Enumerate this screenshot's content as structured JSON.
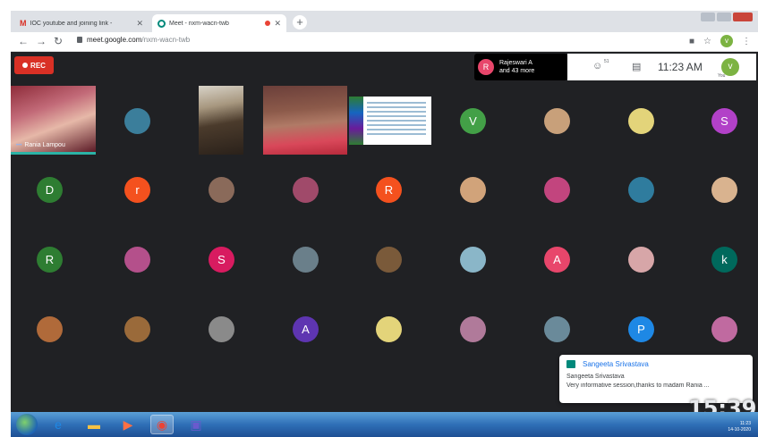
{
  "browser": {
    "tabs": [
      {
        "title": "IOC youtube and joining link -",
        "favicon": "gmail-icon"
      },
      {
        "title": "Meet - nxm-wacn-twb",
        "favicon": "meet-icon"
      }
    ],
    "url_host": "meet.google.com",
    "url_path": "/nxm-wacn-twb",
    "profile_initial": "v"
  },
  "meet": {
    "rec_label": "REC",
    "participants": {
      "initial": "R",
      "line1": "Rajeswari A",
      "line2": "and 43 more",
      "count": "51"
    },
    "clock": "11:23 AM",
    "you_initial": "v",
    "you_label": "You",
    "speaker_name": "Rania Lampou",
    "avatars_row1": [
      {
        "initial": "",
        "color": "#3b7e9b"
      },
      {
        "initial": "V",
        "color": "#43a047"
      },
      {
        "initial": "",
        "color": "#c8a07a"
      },
      {
        "initial": "",
        "color": "#e3d47a"
      },
      {
        "initial": "S",
        "color": "#b241c8"
      }
    ],
    "avatars_row2": [
      {
        "initial": "D",
        "color": "#2e7d32"
      },
      {
        "initial": "r",
        "color": "#f4511e"
      },
      {
        "initial": "",
        "color": "#8a6a5a"
      },
      {
        "initial": "",
        "color": "#a04a6a"
      },
      {
        "initial": "R",
        "color": "#f4511e"
      },
      {
        "initial": "",
        "color": "#d1a37a"
      },
      {
        "initial": "",
        "color": "#c2457e"
      },
      {
        "initial": "",
        "color": "#2f7c9e"
      },
      {
        "initial": "",
        "color": "#d9b38f"
      }
    ],
    "avatars_row3": [
      {
        "initial": "R",
        "color": "#2e7d32"
      },
      {
        "initial": "",
        "color": "#b4508b"
      },
      {
        "initial": "S",
        "color": "#d81b60"
      },
      {
        "initial": "",
        "color": "#6a7f8a"
      },
      {
        "initial": "",
        "color": "#7a5a3a"
      },
      {
        "initial": "",
        "color": "#8ab6c8"
      },
      {
        "initial": "A",
        "color": "#e8466b"
      },
      {
        "initial": "",
        "color": "#d7a6a8"
      },
      {
        "initial": "k",
        "color": "#00695c"
      }
    ],
    "avatars_row4": [
      {
        "initial": "",
        "color": "#b06a3a"
      },
      {
        "initial": "",
        "color": "#9a6a3a"
      },
      {
        "initial": "",
        "color": "#8a8a8a"
      },
      {
        "initial": "A",
        "color": "#5e35b1"
      },
      {
        "initial": "",
        "color": "#e3d47a"
      },
      {
        "initial": "",
        "color": "#b07a9a"
      },
      {
        "initial": "",
        "color": "#6a8a9a"
      },
      {
        "initial": "P",
        "color": "#1e88e5"
      },
      {
        "initial": "",
        "color": "#c06aa0"
      }
    ]
  },
  "toast": {
    "title": "Sangeeta Srivastava",
    "sender": "Sangeeta Srivastava",
    "message": "Very informative session,thanks to madam Rania ..."
  },
  "overlay_clock": "15:39",
  "taskbar": {
    "tray_time": "11:23",
    "tray_date": "14-10-2020"
  }
}
